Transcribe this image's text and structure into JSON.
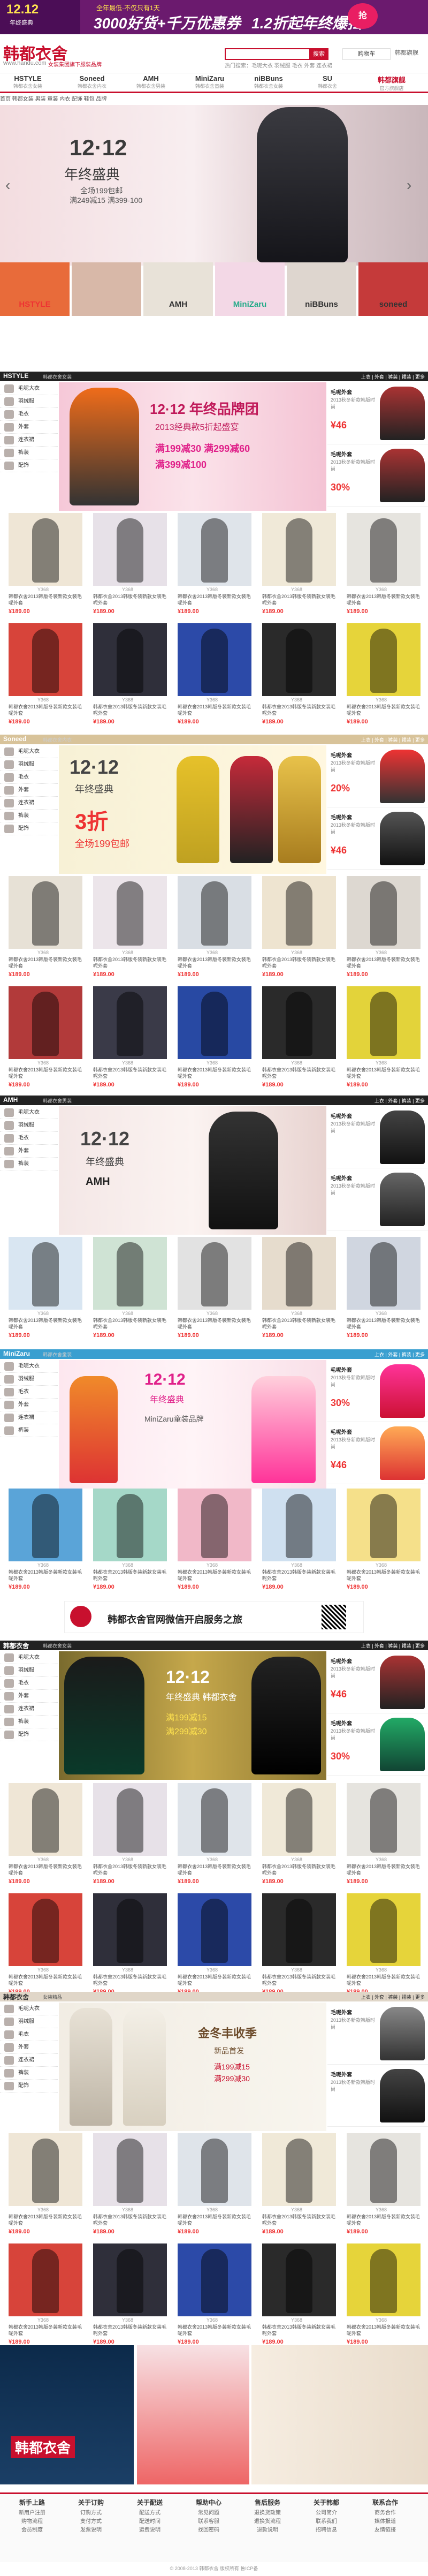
{
  "promo": {
    "date": "12.12",
    "subtitle": "年终盛典",
    "line1": "全年最低·不仅只有1天",
    "line2": "3000好货+千万优惠券",
    "line3": "1.2折起年终爆扫",
    "badge": "抢"
  },
  "header": {
    "logo": "韩都衣舍",
    "domain": "www.handu.com",
    "slogan": "女装集团旗下服装品牌",
    "search_placeholder": "",
    "search_button": "搜索",
    "hot": "热门搜索：毛呢大衣 羽绒服 毛衣 外套 连衣裙",
    "cart": "购物车",
    "mini": "韩都旗舰"
  },
  "brand_nav": [
    {
      "name": "HSTYLE",
      "sub": "韩都衣舍女装"
    },
    {
      "name": "Soneed",
      "sub": "韩都衣舍内衣"
    },
    {
      "name": "AMH",
      "sub": "韩都衣舍男装"
    },
    {
      "name": "MiniZaru",
      "sub": "韩都衣舍童装"
    },
    {
      "name": "niBBuns",
      "sub": "韩都衣舍女装"
    },
    {
      "name": "SU",
      "sub": "韩都衣舍"
    },
    {
      "name": "韩都旗舰",
      "sub": "官方旗舰店"
    }
  ],
  "cat_nav": "首页  韩都女装  男装  童装  内衣  配饰  鞋包  品牌",
  "hero": {
    "title": "12·12",
    "sub": "年终盛典",
    "l1": "全场199包邮",
    "l2": "满249减15 满399-100"
  },
  "brand_tiles": [
    "HSTYLE",
    "",
    "AMH",
    "MiniZaru",
    "niBBuns",
    "soneed"
  ],
  "sections": [
    {
      "name": "HSTYLE",
      "sub": "韩都衣舍女装",
      "tabs": "上衣 | 外套 | 裤装 | 裙装 | 更多"
    },
    {
      "name": "Soneed",
      "sub": "韩都衣舍内衣",
      "tabs": "上衣 | 外套 | 裤装 | 裙装 | 更多"
    },
    {
      "name": "AMH",
      "sub": "韩都衣舍男装",
      "tabs": "上衣 | 外套 | 裤装 | 更多"
    },
    {
      "name": "MiniZaru",
      "sub": "韩都衣舍童装",
      "tabs": "上衣 | 外套 | 裤装 | 更多"
    },
    {
      "name": "韩都衣舍",
      "sub": "韩都衣舍女装",
      "tabs": "上衣 | 外套 | 裤装 | 裙装 | 更多"
    },
    {
      "name": "韩都衣舍",
      "sub": "女装精品",
      "tabs": "上衣 | 外套 | 裤装 | 裙装 | 更多"
    }
  ],
  "side_items": [
    "毛呢大衣",
    "羽绒服",
    "毛衣",
    "外套",
    "连衣裙",
    "裤装",
    "配饰"
  ],
  "banners": [
    {
      "title": "12·12 年终品牌团",
      "sub": "2013经典款5折起盛宴",
      "l1": "满199减30 满299减60",
      "l2": "满399减100"
    },
    {
      "title": "12·12",
      "sub": "年终盛典",
      "l1": "3折",
      "l2": "全场199包邮"
    },
    {
      "title": "12·12",
      "sub": "年终盛典",
      "l1": "AMH",
      "l2": ""
    },
    {
      "title": "12·12",
      "sub": "年终盛典",
      "l1": "MiniZaru童装品牌",
      "l2": ""
    },
    {
      "title": "12·12",
      "sub": "年终盛典 韩都衣舍",
      "l1": "满199减15",
      "l2": "满299减30"
    },
    {
      "title": "金冬丰收季",
      "sub": "新品首发",
      "l1": "满199减15",
      "l2": "满299减30"
    }
  ],
  "right_cards": [
    {
      "title": "毛呢外套",
      "desc": "2013秋冬新款韩版时尚",
      "price": "¥46"
    },
    {
      "title": "毛呢外套",
      "desc": "2013秋冬新款韩版时尚",
      "price": "30%"
    },
    {
      "title": "毛呢外套",
      "desc": "2013秋冬新款韩版时尚",
      "price": "20%"
    }
  ],
  "product": {
    "title": "韩都衣舍2013韩版冬装新款女装毛呢外套",
    "price": "¥189.00",
    "tag": "Y368"
  },
  "featured": "韩都衣舍官网微信开启服务之旅",
  "footer": [
    {
      "title": "新手上路",
      "items": [
        "新用户注册",
        "购物流程",
        "会员制度"
      ]
    },
    {
      "title": "关于订购",
      "items": [
        "订购方式",
        "支付方式",
        "发票说明"
      ]
    },
    {
      "title": "关于配送",
      "items": [
        "配送方式",
        "配送时间",
        "运费说明"
      ]
    },
    {
      "title": "帮助中心",
      "items": [
        "常见问题",
        "联系客服",
        "找回密码"
      ]
    },
    {
      "title": "售后服务",
      "items": [
        "退换货政策",
        "退换货流程",
        "退款说明"
      ]
    },
    {
      "title": "关于韩都",
      "items": [
        "公司简介",
        "联系我们",
        "招聘信息"
      ]
    },
    {
      "title": "联系合作",
      "items": [
        "商务合作",
        "媒体报道",
        "友情链接"
      ]
    }
  ],
  "copyright": "© 2008-2013 韩都衣舍 版权所有 鲁ICP备"
}
